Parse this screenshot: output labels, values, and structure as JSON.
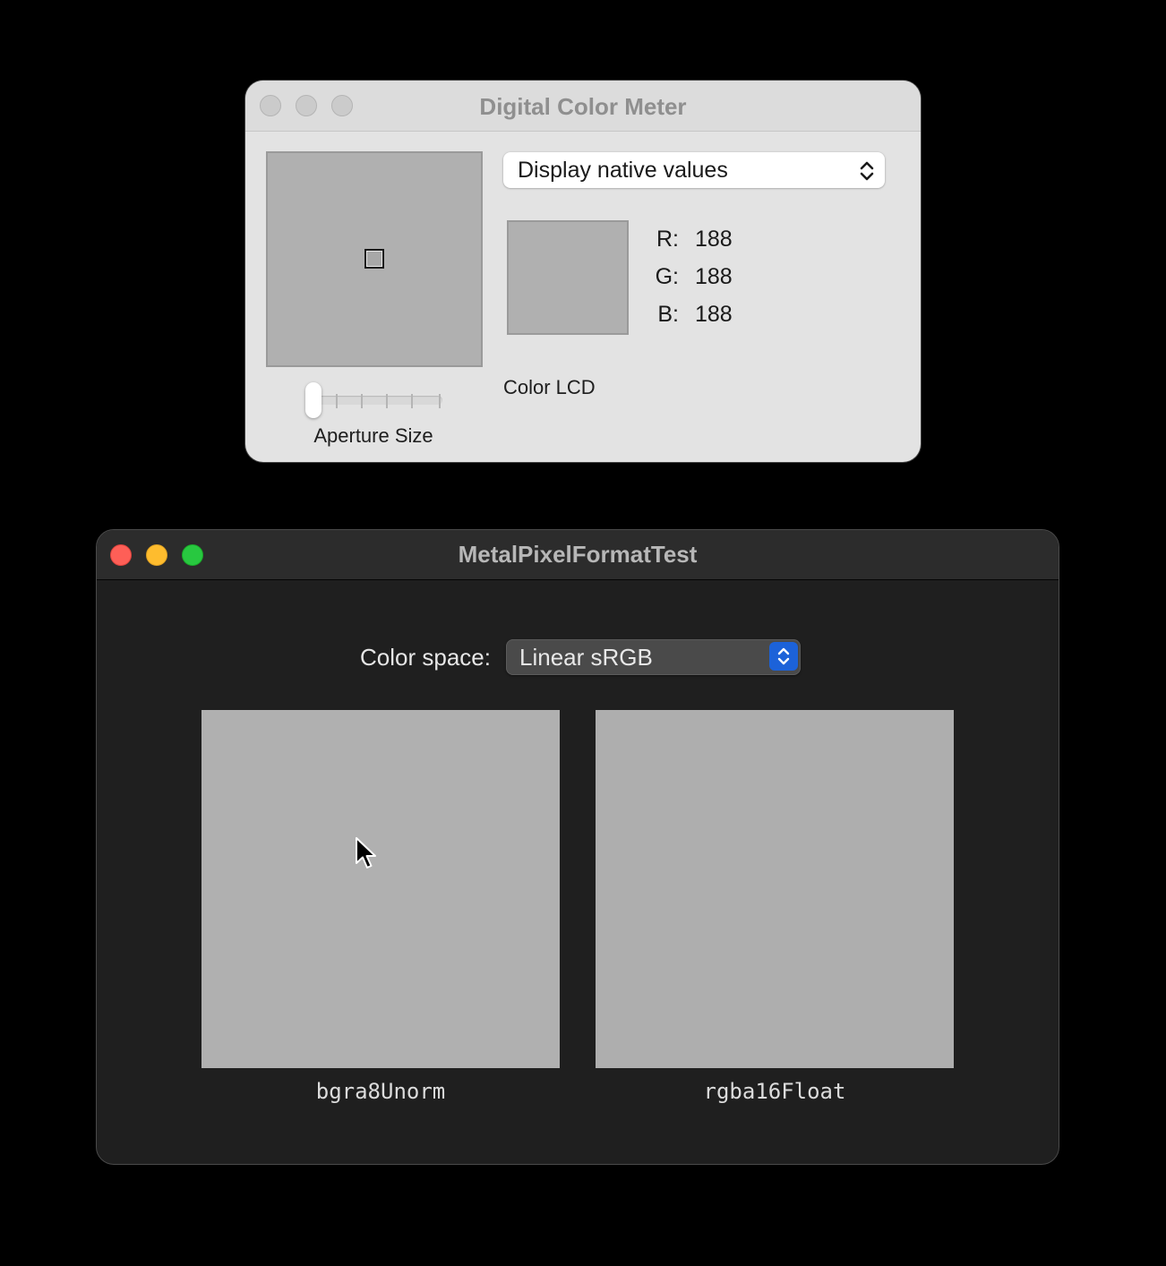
{
  "color_meter_window": {
    "title": "Digital Color Meter",
    "window_buttons": [
      "close-button",
      "minimize-button",
      "zoom-button"
    ],
    "aperture_preview_color": "#b0b0b0",
    "aperture_size_label": "Aperture Size",
    "aperture_size_level": 0,
    "display_mode": {
      "selected": "Display native values",
      "icon": "chevron-up-down-icon"
    },
    "sample_color": "#b0b0b0",
    "channels": [
      {
        "label": "R:",
        "value": "188"
      },
      {
        "label": "G:",
        "value": "188"
      },
      {
        "label": "B:",
        "value": "188"
      }
    ],
    "display_name": "Color LCD"
  },
  "metal_window": {
    "title": "MetalPixelFormatTest",
    "window_buttons": {
      "close_color": "#fe5f57",
      "minimize_color": "#febc2e",
      "zoom_color": "#28c840"
    },
    "color_space": {
      "label": "Color space:",
      "selected": "Linear sRGB",
      "accent": "#1c62d9",
      "icon": "chevron-up-down-icon"
    },
    "panels": [
      {
        "label": "bgra8Unorm",
        "color": "#b0b0b0"
      },
      {
        "label": "rgba16Float",
        "color": "#aeaeae"
      }
    ]
  },
  "cursor": {
    "icon": "arrow-cursor-icon"
  }
}
